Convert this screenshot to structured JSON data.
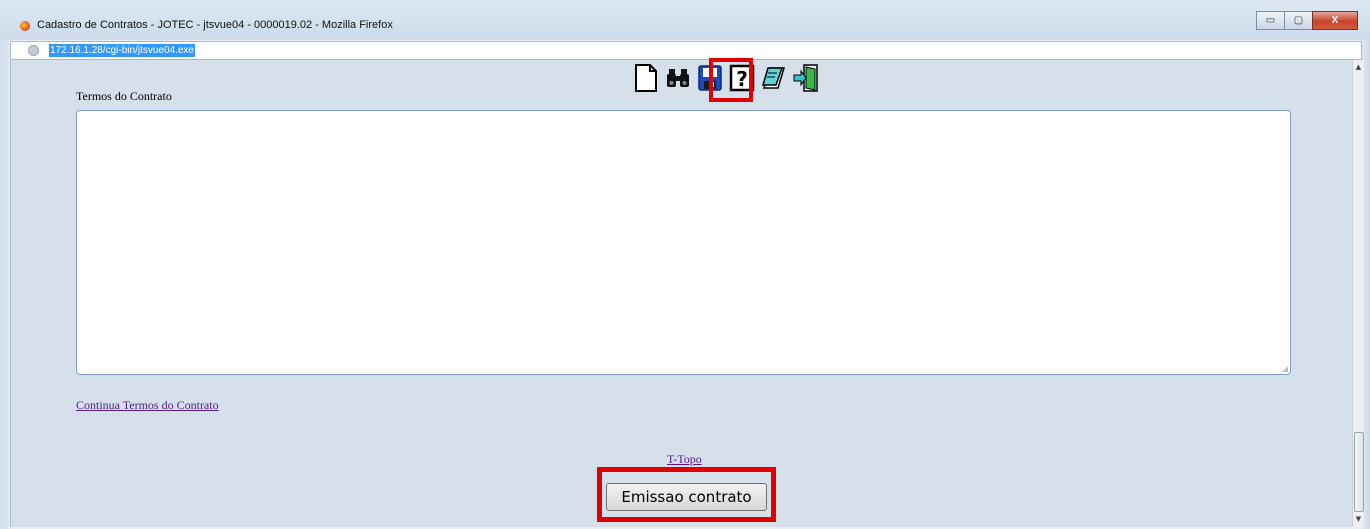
{
  "window": {
    "title": "Cadastro de Contratos - JOTEC - jtsvue04 - 0000019.02 - Mozilla Firefox",
    "controls": {
      "minimize": "▭",
      "maximize": "▢",
      "close": "X"
    }
  },
  "address_bar": {
    "url": "172.16.1.28/cgi-bin/jtsvue04.exe"
  },
  "toolbar": {
    "icons": [
      "new-document-icon",
      "search-binoculars-icon",
      "save-floppy-icon",
      "help-question-icon",
      "notes-icon",
      "exit-door-icon"
    ],
    "highlighted": "save-floppy-icon"
  },
  "form": {
    "terms_label": "Termos do Contrato",
    "terms_value": "",
    "continue_link": "Continua Termos do Contrato",
    "top_link": "T-Topo",
    "emit_button": "Emissao contrato"
  },
  "colors": {
    "highlight": "#e00000",
    "page_bg": "#d6e0ea",
    "link": "#551a8b"
  }
}
